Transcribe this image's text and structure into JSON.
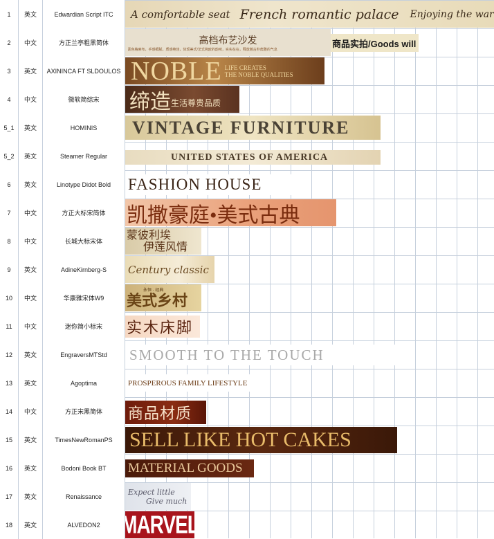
{
  "rows": [
    {
      "idx": "1",
      "lang": "英文",
      "font": "Edwardian Script ITC",
      "sample": [
        "A comfortable seat",
        "French romantic palace",
        "Enjoying the warmth"
      ]
    },
    {
      "idx": "2",
      "lang": "中文",
      "font": "方正兰亭粗黑简体",
      "sample": [
        "高档布艺沙发",
        "商品实拍/Goods will",
        "素色格麻布，手感细腻，质感绝佳，体现美式/法式简欧的韵味，实实在在，释放着古朴典雅的气息"
      ]
    },
    {
      "idx": "3",
      "lang": "英文",
      "font": "AXININCA FT SLDOULOS",
      "sample": [
        "NOBLE",
        "LIFE CREATES",
        "THE NOBLE QUALITIES"
      ]
    },
    {
      "idx": "4",
      "lang": "中文",
      "font": "微软简综宋",
      "sample": [
        "缔造",
        "生活尊贵品质"
      ]
    },
    {
      "idx": "5_1",
      "lang": "英文",
      "font": "HOMINIS",
      "sample": [
        "VINTAGE FURNITURE"
      ]
    },
    {
      "idx": "5_2",
      "lang": "英文",
      "font": "Steamer Regular",
      "sample": [
        "UNITED STATES OF AMERICA"
      ]
    },
    {
      "idx": "6",
      "lang": "英文",
      "font": "Linotype Didot Bold",
      "sample": [
        "FASHION HOUSE"
      ]
    },
    {
      "idx": "7",
      "lang": "中文",
      "font": "方正大标宋简体",
      "sample": [
        "凯撒豪庭•美式古典"
      ]
    },
    {
      "idx": "8",
      "lang": "中文",
      "font": "长城大标宋体",
      "sample": [
        "蒙彼利埃",
        "伊莲风情"
      ]
    },
    {
      "idx": "9",
      "lang": "英文",
      "font": "AdineKirnberg-S",
      "sample": [
        "Century classic"
      ]
    },
    {
      "idx": "10",
      "lang": "中文",
      "font": "华康雅宋体W9",
      "sample": [
        "美式乡村",
        "永恒 · 经典"
      ]
    },
    {
      "idx": "11",
      "lang": "中文",
      "font": "迷你简小标宋",
      "sample": [
        "实木床脚"
      ]
    },
    {
      "idx": "12",
      "lang": "英文",
      "font": "EngraversMTStd",
      "sample": [
        "SMOOTH TO THE TOUCH"
      ]
    },
    {
      "idx": "13",
      "lang": "英文",
      "font": "Agoptima",
      "sample": [
        "PROSPEROUS FAMILY LIFESTYLE"
      ]
    },
    {
      "idx": "14",
      "lang": "中文",
      "font": "方正宋黑简体",
      "sample": [
        "商品材质"
      ]
    },
    {
      "idx": "15",
      "lang": "英文",
      "font": "TimesNewRomanPS",
      "sample": [
        "SELL LIKE HOT CAKES"
      ]
    },
    {
      "idx": "16",
      "lang": "英文",
      "font": "Bodoni Book BT",
      "sample": [
        "MATERIAL GOODS"
      ]
    },
    {
      "idx": "17",
      "lang": "英文",
      "font": "Renaissance",
      "sample": [
        "Expect little",
        "Give much"
      ]
    },
    {
      "idx": "18",
      "lang": "英文",
      "font": "ALVEDON2",
      "sample": [
        "MARVEL"
      ]
    }
  ],
  "colors": {
    "grid": "#c5cfdc",
    "gold": "#e9dcbf",
    "brown": "#6a3b18",
    "darkred": "#5a1a0c",
    "orange": "#e8a27a"
  }
}
